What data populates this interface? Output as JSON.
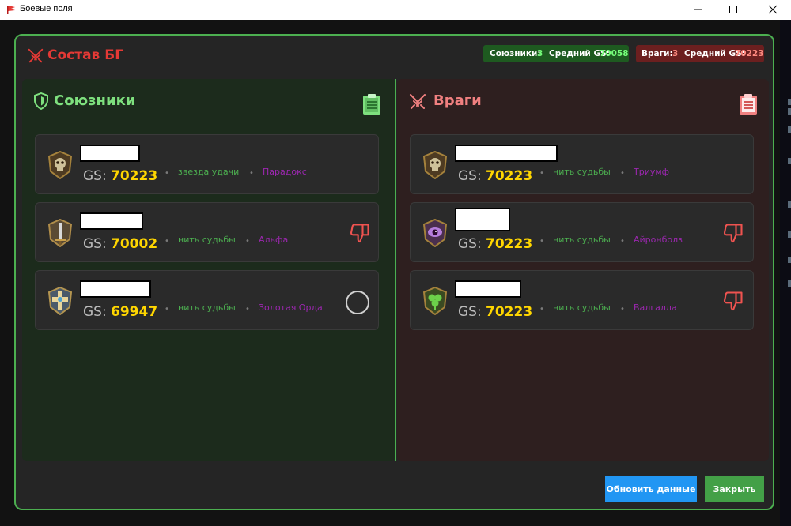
{
  "window": {
    "title": "Боевые поля",
    "minimize_icon": "minimize-icon",
    "maximize_icon": "maximize-icon",
    "close_icon": "close-icon"
  },
  "dialog": {
    "title": "Состав БГ",
    "title_icon": "crossed-swords-icon",
    "accent_color": "#4caf50",
    "title_color": "#e53935"
  },
  "summary": {
    "allies": {
      "label": "Союзники:",
      "count": "3",
      "avg_label": "Средний GS:",
      "avg_value": "70058"
    },
    "enemies": {
      "label": "Враги:",
      "count": "3",
      "avg_label": "Средний GS:",
      "avg_value": "70223"
    }
  },
  "allies": {
    "title": "Союзники",
    "icon": "shield-icon",
    "copy_icon": "clipboard-icon",
    "players": [
      {
        "gs_label": "GS:",
        "gs": "70223",
        "realm": "звезда удачи",
        "guild": "Парадокс",
        "avatar": "skull-emblem-icon",
        "action": ""
      },
      {
        "gs_label": "GS:",
        "gs": "70002",
        "realm": "нить судьбы",
        "guild": "Альфа",
        "avatar": "sword-emblem-icon",
        "action": "thumbs-down-icon"
      },
      {
        "gs_label": "GS:",
        "gs": "69947",
        "realm": "нить судьбы",
        "guild": "Золотая Орда",
        "avatar": "cross-emblem-icon",
        "action": "circle-icon"
      }
    ]
  },
  "enemies": {
    "title": "Враги",
    "icon": "crossed-swords-icon",
    "copy_icon": "clipboard-icon",
    "players": [
      {
        "gs_label": "GS:",
        "gs": "70223",
        "realm": "нить судьбы",
        "guild": "Триумф",
        "avatar": "skull-emblem-icon",
        "action": ""
      },
      {
        "gs_label": "GS:",
        "gs": "70223",
        "realm": "нить судьбы",
        "guild": "Айронболз",
        "avatar": "eye-emblem-icon",
        "action": "thumbs-down-icon"
      },
      {
        "gs_label": "GS:",
        "gs": "70223",
        "realm": "нить судьбы",
        "guild": "Валгалла",
        "avatar": "clover-emblem-icon",
        "action": "thumbs-down-icon"
      }
    ]
  },
  "buttons": {
    "refresh": "Обновить данные",
    "close": "Закрыть"
  }
}
